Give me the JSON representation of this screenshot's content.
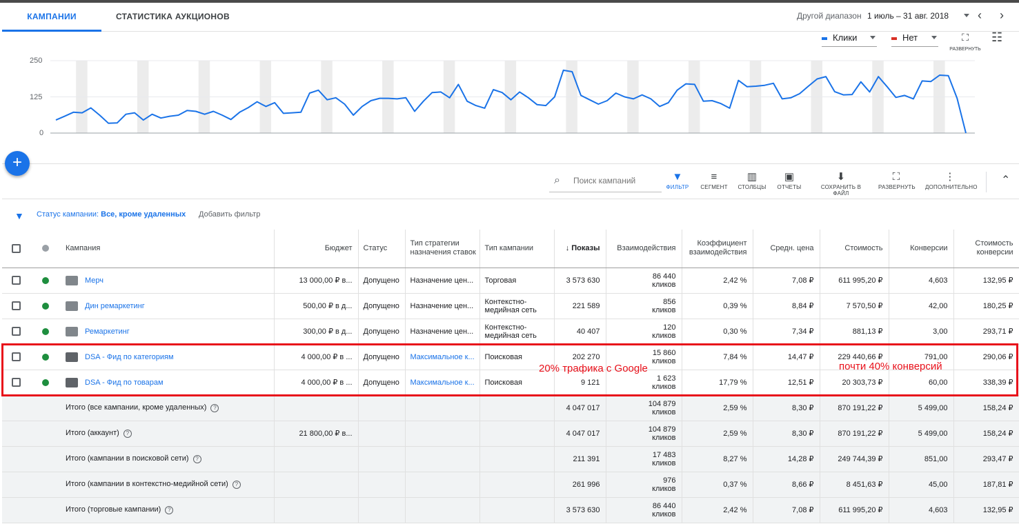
{
  "tabs": [
    {
      "label": "КАМПАНИИ"
    },
    {
      "label": "СТАТИСТИКА АУКЦИОНОВ"
    }
  ],
  "date_range": {
    "label": "Другой диапазон",
    "value": "1 июль – 31 авг. 2018"
  },
  "chart": {
    "metric1": "Клики",
    "metric1_color": "#1a73e8",
    "metric2": "Нет",
    "metric2_color": "#d93025",
    "expand_label": "РАЗВЕРНУТЬ",
    "y_ticks": [
      "250",
      "125",
      "0"
    ]
  },
  "chart_data": {
    "type": "line",
    "ylim": [
      0,
      250
    ],
    "series": [
      {
        "values": [
          45,
          58,
          72,
          70,
          87,
          62,
          34,
          35,
          65,
          70,
          45,
          65,
          52,
          58,
          62,
          78,
          75,
          65,
          75,
          62,
          47,
          72,
          88,
          108,
          92,
          105,
          68,
          70,
          72,
          138,
          148,
          115,
          122,
          100,
          62,
          92,
          112,
          120,
          120,
          118,
          122,
          75,
          110,
          140,
          142,
          122,
          168,
          110,
          95,
          86,
          150,
          140,
          115,
          142,
          122,
          98,
          95,
          125,
          217,
          212,
          130,
          115,
          100,
          112,
          138,
          125,
          118,
          132,
          118,
          92,
          105,
          148,
          170,
          168,
          110,
          112,
          102,
          86,
          182,
          160,
          162,
          165,
          172,
          118,
          122,
          136,
          162,
          187,
          195,
          143,
          132,
          133,
          177,
          142,
          195,
          160,
          123,
          130,
          118,
          180,
          178,
          200,
          198,
          120,
          0
        ]
      }
    ]
  },
  "toolbar": {
    "search_placeholder": "Поиск кампаний",
    "filter": "ФИЛЬТР",
    "segment": "СЕГМЕНТ",
    "columns": "СТОЛБЦЫ",
    "reports": "ОТЧЕТЫ",
    "download": "СОХРАНИТЬ В ФАЙЛ",
    "expand": "РАЗВЕРНУТЬ",
    "more": "ДОПОЛНИТЕЛЬНО"
  },
  "filter": {
    "prefix": "Статус кампании:",
    "value": "Все, кроме удаленных",
    "add": "Добавить фильтр"
  },
  "columns": {
    "campaign": "Кампания",
    "budget": "Бюджет",
    "status": "Статус",
    "strategy": "Тип стратегии назначения ставок",
    "type": "Тип кампании",
    "impressions": "Показы",
    "interactions": "Взаимодействия",
    "interaction_rate": "Коэффициент взаимодействия",
    "avg_cost": "Средн. цена",
    "cost": "Стоимость",
    "conversions": "Конверсии",
    "cost_conv": "Стоимость конверсии"
  },
  "rows": [
    {
      "name": "Мерч",
      "budget": "13 000,00 ₽ в...",
      "status": "Допущено",
      "strategy": "Назначение цен...",
      "type": "Торговая",
      "impressions": "3 573 630",
      "interactions": "86 440",
      "interactions_unit": "кликов",
      "rate": "2,42 %",
      "avg": "7,08 ₽",
      "cost": "611 995,20 ₽",
      "conv": "4,603",
      "cpc": "132,95 ₽"
    },
    {
      "name": "Дин ремаркетинг",
      "budget": "500,00 ₽ в д...",
      "status": "Допущено",
      "strategy": "Назначение цен...",
      "type": "Контекстно-медийная сеть",
      "impressions": "221 589",
      "interactions": "856",
      "interactions_unit": "кликов",
      "rate": "0,39 %",
      "avg": "8,84 ₽",
      "cost": "7 570,50 ₽",
      "conv": "42,00",
      "cpc": "180,25 ₽"
    },
    {
      "name": "Ремаркетинг",
      "budget": "300,00 ₽ в д...",
      "status": "Допущено",
      "strategy": "Назначение цен...",
      "type": "Контекстно-медийная сеть",
      "impressions": "40 407",
      "interactions": "120",
      "interactions_unit": "кликов",
      "rate": "0,30 %",
      "avg": "7,34 ₽",
      "cost": "881,13 ₽",
      "conv": "3,00",
      "cpc": "293,71 ₽"
    },
    {
      "name": "DSA - Фид по категориям",
      "budget": "4 000,00 ₽ в ...",
      "status": "Допущено",
      "strategy": "Максимальное к...",
      "type": "Поисковая",
      "impressions": "202 270",
      "interactions": "15 860",
      "interactions_unit": "кликов",
      "rate": "7,84 %",
      "avg": "14,47 ₽",
      "cost": "229 440,66 ₽",
      "conv": "791,00",
      "cpc": "290,06 ₽"
    },
    {
      "name": "DSA - Фид по товарам",
      "budget": "4 000,00 ₽ в ...",
      "status": "Допущено",
      "strategy": "Максимальное к...",
      "type": "Поисковая",
      "impressions": "9 121",
      "interactions": "1 623",
      "interactions_unit": "кликов",
      "rate": "17,79 %",
      "avg": "12,51 ₽",
      "cost": "20 303,73 ₽",
      "conv": "60,00",
      "cpc": "338,39 ₽"
    }
  ],
  "totals": [
    {
      "name": "Итого (все кампании, кроме удаленных)",
      "budget": "",
      "impressions": "4 047 017",
      "interactions": "104 879",
      "interactions_unit": "кликов",
      "rate": "2,59 %",
      "avg": "8,30 ₽",
      "cost": "870 191,22 ₽",
      "conv": "5 499,00",
      "cpc": "158,24 ₽"
    },
    {
      "name": "Итого (аккаунт)",
      "budget": "21 800,00 ₽ в...",
      "impressions": "4 047 017",
      "interactions": "104 879",
      "interactions_unit": "кликов",
      "rate": "2,59 %",
      "avg": "8,30 ₽",
      "cost": "870 191,22 ₽",
      "conv": "5 499,00",
      "cpc": "158,24 ₽"
    },
    {
      "name": "Итого (кампании в поисковой сети)",
      "budget": "",
      "impressions": "211 391",
      "interactions": "17 483",
      "interactions_unit": "кликов",
      "rate": "8,27 %",
      "avg": "14,28 ₽",
      "cost": "249 744,39 ₽",
      "conv": "851,00",
      "cpc": "293,47 ₽"
    },
    {
      "name": "Итого (кампании в контекстно-медийной сети)",
      "budget": "",
      "impressions": "261 996",
      "interactions": "976",
      "interactions_unit": "кликов",
      "rate": "0,37 %",
      "avg": "8,66 ₽",
      "cost": "8 451,63 ₽",
      "conv": "45,00",
      "cpc": "187,81 ₽"
    },
    {
      "name": "Итого (торговые кампании)",
      "budget": "",
      "impressions": "3 573 630",
      "interactions": "86 440",
      "interactions_unit": "кликов",
      "rate": "2,42 %",
      "avg": "7,08 ₽",
      "cost": "611 995,20 ₽",
      "conv": "4,603",
      "cpc": "132,95 ₽"
    }
  ],
  "annotations": {
    "left": "20% трафика с Google",
    "right": "почти 40% конверсий",
    "color": "#e8101a"
  }
}
